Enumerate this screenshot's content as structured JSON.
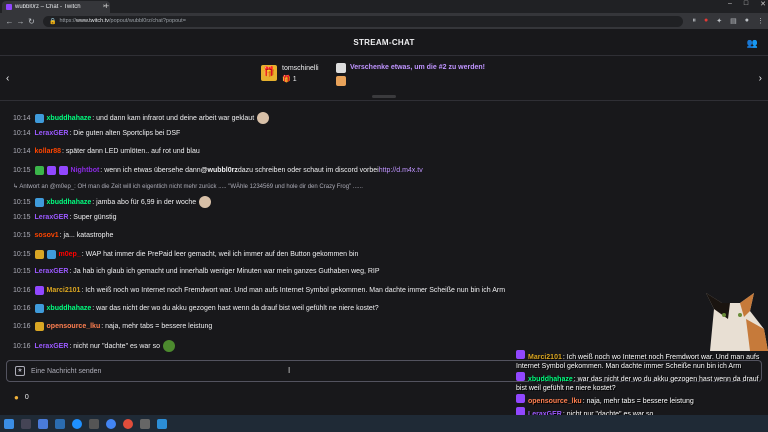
{
  "browser": {
    "tab_title": "wubbl0rz – Chat - Twitch",
    "tab_close": "×",
    "new_tab": "+",
    "url_prefix": "https://",
    "url_host": "www.twitch.tv",
    "url_path": "/popout/wubbl0rz/chat?popout="
  },
  "header": {
    "title": "STREAM-CHAT"
  },
  "pinned": {
    "user": "tomschinelli",
    "count": "1",
    "cta": "Verschenke etwas, um die #2 zu werden!"
  },
  "colors": {
    "bg": "#18181b",
    "purple": "#9147ff",
    "link": "#bf94ff"
  },
  "messages": [
    {
      "time": "10:14",
      "badges": [
        "blue"
      ],
      "user": "xbuddhahaze",
      "color": "#00ff7f",
      "text": "und dann kam infrarot und deine arbeit war geklaut",
      "emote": true
    },
    {
      "time": "10:14",
      "badges": [],
      "user": "LeraxGER",
      "color": "#9b59ff",
      "text": "Die guten alten Sportclips bei DSF"
    },
    {
      "time": "10:14",
      "badges": [],
      "user": "kollar88",
      "color": "#ff4500",
      "text": "später dann LED umlöten.. auf rot und blau"
    },
    {
      "time": "10:15",
      "badges": [
        "green",
        "purple",
        "purple"
      ],
      "user": "Nightbot",
      "color": "#8a2be2",
      "text_before": "wenn ich etwas übersehe dann ",
      "mention": "@wubbl0rz",
      "text_after": " dazu schreiben oder schaut im discord vorbei ",
      "link": "http://d.m4x.tv"
    },
    {
      "time": "10:15",
      "badges": [
        "blue"
      ],
      "user": "xbuddhahaze",
      "color": "#00ff7f",
      "text": "jamba abo für 6,99 in der woche",
      "emote": true,
      "reply": "Antwort an @m0ep_: OH man die Zeit will ich eigentlich nicht mehr zurück ..... \"WÄhle 1234569 und hole dir den Crazy Frog\" ......"
    },
    {
      "time": "10:15",
      "badges": [],
      "user": "LeraxGER",
      "color": "#9b59ff",
      "text": "Super günstig"
    },
    {
      "time": "10:15",
      "badges": [],
      "user": "sosov1",
      "color": "#ff4500",
      "text": "ja... katastrophe"
    },
    {
      "time": "10:15",
      "badges": [
        "gold",
        "blue"
      ],
      "user": "m0ep_",
      "color": "#ff0000",
      "text": "WAP hat immer die PrePaid leer gemacht, weil ich immer auf den Button gekommen bin"
    },
    {
      "time": "10:15",
      "badges": [],
      "user": "LeraxGER",
      "color": "#9b59ff",
      "text": "Ja hab ich glaub ich gemacht und innerhalb weniger Minuten war mein ganzes Guthaben weg, RIP"
    },
    {
      "time": "10:16",
      "badges": [
        "purple"
      ],
      "user": "Marci2101",
      "color": "#daa520",
      "text": "Ich weiß noch wo Internet noch Fremdwort war. Und man aufs Internet Symbol gekommen. Man dachte immer Scheiße nun bin ich Arm"
    },
    {
      "time": "10:16",
      "badges": [
        "blue"
      ],
      "user": "xbuddhahaze",
      "color": "#00ff7f",
      "text": "war das nicht der wo du akku gezogen hast wenn da drauf bist weil gefühlt ne niere kostet?"
    },
    {
      "time": "10:16",
      "badges": [
        "gold"
      ],
      "user": "opensource_lku",
      "color": "#ff7f50",
      "text": "naja, mehr tabs = bessere leistung"
    },
    {
      "time": "10:16",
      "badges": [],
      "user": "LeraxGER",
      "color": "#9b59ff",
      "text": "nicht nur \"dachte\" es war so",
      "emote": true
    }
  ],
  "input": {
    "placeholder": "Eine Nachricht senden"
  },
  "points": {
    "value": "0"
  },
  "overlay": [
    {
      "user": "Marci2101",
      "color": "#daa520",
      "text": "Ich weiß noch wo Internet noch Fremdwort war. Und man aufs Internet Symbol gekommen. Man dachte immer Scheiße nun bin ich Arm"
    },
    {
      "user": "xbuddhahaze",
      "color": "#00ff7f",
      "text": "war das nicht der wo du akku gezogen hast wenn da drauf bist weil gefühlt ne niere kostet?"
    },
    {
      "user": "opensource_lku",
      "color": "#ff7f50",
      "text": "naja, mehr tabs = bessere leistung"
    },
    {
      "user": "LeraxGER",
      "color": "#9b59ff",
      "text": "nicht nur \"dachte\" es war so"
    }
  ],
  "icons": {
    "back": "back-arrow-icon",
    "forward": "forward-arrow-icon",
    "reload": "reload-icon",
    "users": "users-icon",
    "gift": "gift-icon",
    "points": "channel-points-icon"
  }
}
